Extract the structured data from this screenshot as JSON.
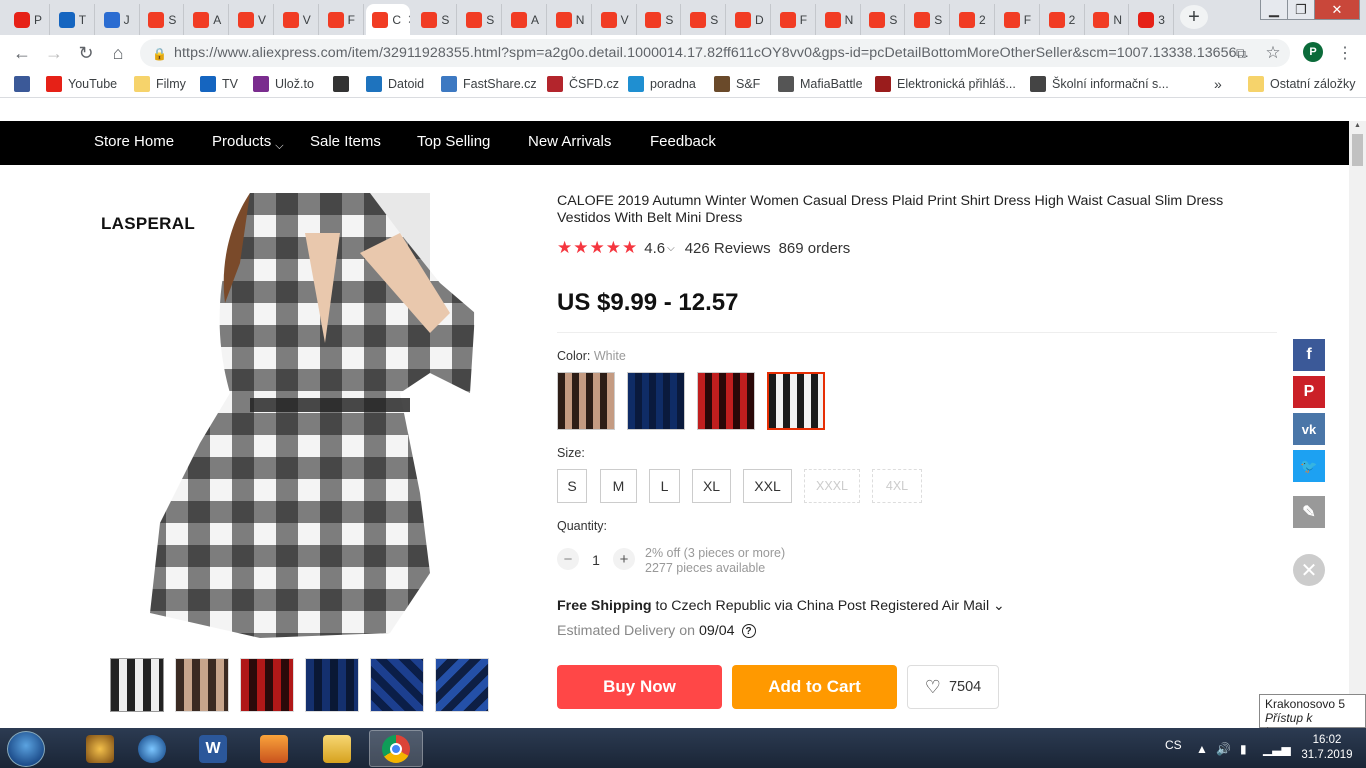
{
  "browser": {
    "tabs": [
      {
        "icon": "youtube-icon",
        "label": "P"
      },
      {
        "icon": "tv-icon",
        "label": "T"
      },
      {
        "icon": "j-icon",
        "label": "J"
      },
      {
        "icon": "aliexpress-icon",
        "label": "S"
      },
      {
        "icon": "aliexpress-icon",
        "label": "A"
      },
      {
        "icon": "aliexpress-icon",
        "label": "V"
      },
      {
        "icon": "aliexpress-icon",
        "label": "V"
      },
      {
        "icon": "aliexpress-icon",
        "label": "F"
      },
      {
        "icon": "aliexpress-icon",
        "label": "C",
        "active": true
      },
      {
        "icon": "aliexpress-icon",
        "label": "S"
      },
      {
        "icon": "aliexpress-icon",
        "label": "S"
      },
      {
        "icon": "aliexpress-icon",
        "label": "A"
      },
      {
        "icon": "aliexpress-icon",
        "label": "N"
      },
      {
        "icon": "aliexpress-icon",
        "label": "V"
      },
      {
        "icon": "aliexpress-icon",
        "label": "S"
      },
      {
        "icon": "aliexpress-icon",
        "label": "S"
      },
      {
        "icon": "aliexpress-icon",
        "label": "D"
      },
      {
        "icon": "aliexpress-icon",
        "label": "F"
      },
      {
        "icon": "aliexpress-icon",
        "label": "N"
      },
      {
        "icon": "aliexpress-icon",
        "label": "S"
      },
      {
        "icon": "aliexpress-icon",
        "label": "S"
      },
      {
        "icon": "aliexpress-icon",
        "label": "2"
      },
      {
        "icon": "aliexpress-icon",
        "label": "F"
      },
      {
        "icon": "aliexpress-icon",
        "label": "2"
      },
      {
        "icon": "aliexpress-icon",
        "label": "N"
      },
      {
        "icon": "youtube-icon",
        "label": "3"
      }
    ],
    "url": "https://www.aliexpress.com/item/32911928355.html?spm=a2g0o.detail.1000014.17.82ff611cOY8vv0&gps-id=pcDetailBottomMoreOtherSeller&scm=1007.13338.13656...",
    "profile_initial": "P",
    "bookmarks": [
      {
        "icon": "facebook-icon",
        "label": "",
        "color": "#3b5998"
      },
      {
        "icon": "youtube-icon",
        "label": "YouTube",
        "color": "#e62117"
      },
      {
        "icon": "folder-icon",
        "label": "Filmy",
        "color": "#f6d36b"
      },
      {
        "icon": "tv-icon",
        "label": "TV",
        "color": "#1565c0"
      },
      {
        "icon": "ulozto-icon",
        "label": "Ulož.to",
        "color": "#7a2c8e"
      },
      {
        "icon": "gear-icon",
        "label": "",
        "color": "#333333"
      },
      {
        "icon": "datoid-icon",
        "label": "Datoid",
        "color": "#1e73be"
      },
      {
        "icon": "fastshare-icon",
        "label": "FastShare.cz",
        "color": "#3d79c2"
      },
      {
        "icon": "csfd-icon",
        "label": "ČSFD.cz",
        "color": "#b3252c"
      },
      {
        "icon": "poradna-icon",
        "label": "poradna",
        "color": "#1f8fd1"
      },
      {
        "icon": "sf-icon",
        "label": "S&F",
        "color": "#6a4a2a"
      },
      {
        "icon": "mafiabattle-icon",
        "label": "MafiaBattle",
        "color": "#555555"
      },
      {
        "icon": "uis-icon",
        "label": "Elektronická přihláš...",
        "color": "#9a1c1c"
      },
      {
        "icon": "school-icon",
        "label": "Školní informační s...",
        "color": "#444444"
      }
    ],
    "bookmarks_more": "»",
    "other_bookmarks": "Ostatní záložky"
  },
  "store_nav": [
    "Store Home",
    "Products",
    "Sale Items",
    "Top Selling",
    "New Arrivals",
    "Feedback"
  ],
  "product": {
    "brand": "LASPERAL",
    "title": "CALOFE 2019 Autumn Winter Women Casual Dress Plaid Print Shirt Dress High Waist Casual Slim Dress Vestidos With Belt Mini Dress",
    "rating": "4.6",
    "reviews": "426 Reviews",
    "orders": "869 orders",
    "stars": 5,
    "price": "US $9.99 - 12.57",
    "color_label": "Color:",
    "color_value": "White",
    "color_swatches": [
      "brown plaid",
      "blue plaid",
      "red plaid",
      "white plaid"
    ],
    "size_label": "Size:",
    "sizes": [
      {
        "label": "S",
        "available": true
      },
      {
        "label": "M",
        "available": true
      },
      {
        "label": "L",
        "available": true
      },
      {
        "label": "XL",
        "available": true
      },
      {
        "label": "XXL",
        "available": true
      },
      {
        "label": "XXXL",
        "available": false
      },
      {
        "label": "4XL",
        "available": false
      }
    ],
    "quantity_label": "Quantity:",
    "quantity": "1",
    "discount_text": "2% off (3 pieces or more)",
    "available_text": "2277 pieces available",
    "shipping_bold": "Free Shipping",
    "shipping_rest": " to Czech Republic via China Post Registered Air Mail ⌄",
    "delivery_label": "Estimated Delivery on",
    "delivery_date": "09/04",
    "buy_now": "Buy Now",
    "add_to_cart": "Add to Cart",
    "wishlist_count": "7504"
  },
  "social": [
    {
      "icon": "facebook-icon",
      "color": "#3b5998"
    },
    {
      "icon": "pinterest-icon",
      "color": "#cb2027"
    },
    {
      "icon": "vk-icon",
      "color": "#4a76a8"
    },
    {
      "icon": "twitter-icon",
      "color": "#1da1f2"
    },
    {
      "icon": "edit-icon",
      "color": "#999999"
    }
  ],
  "tooltip": {
    "line1": "Krakonosovo  5",
    "line2": "Přístup k Internetu"
  },
  "taskbar": {
    "lang": "CS",
    "time": "16:02",
    "date": "31.7.2019"
  }
}
